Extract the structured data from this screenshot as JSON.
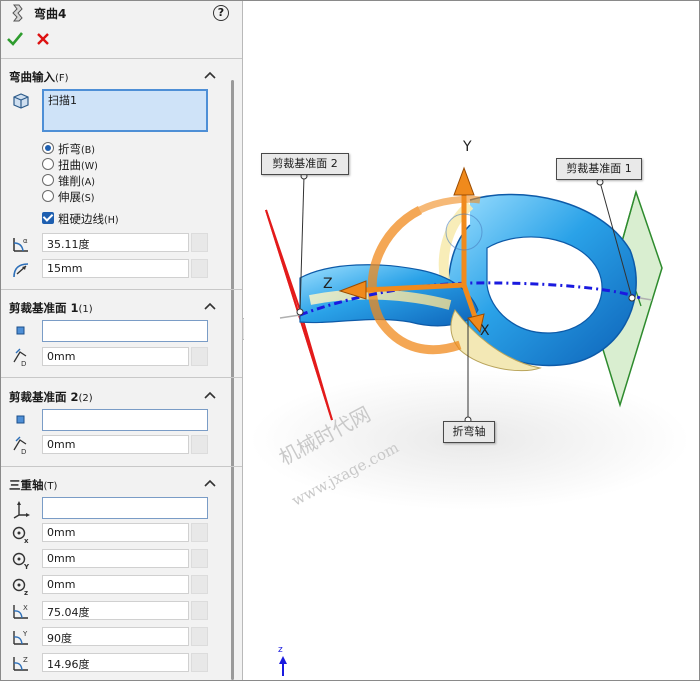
{
  "feature": {
    "title": "弯曲4",
    "help_icon": "help-icon",
    "help_glyph": "?"
  },
  "actions": {
    "ok_icon": "check-icon",
    "cancel_icon": "close-icon"
  },
  "bend_input": {
    "header": "弯曲输入",
    "header_key": "(F)",
    "selected_body": "扫描1",
    "options": [
      {
        "label": "折弯",
        "key": "(B)",
        "selected": true
      },
      {
        "label": "扭曲",
        "key": "(W)",
        "selected": false
      },
      {
        "label": "锥削",
        "key": "(A)",
        "selected": false
      },
      {
        "label": "伸展",
        "key": "(S)",
        "selected": false
      }
    ],
    "hard_edges": {
      "label": "粗硬边线",
      "key": "(H)",
      "checked": true
    },
    "angle": "35.11度",
    "radius": "15mm"
  },
  "trim_plane_1": {
    "header": "剪裁基准面 1",
    "header_key": "(1)",
    "reference": "",
    "distance": "0mm"
  },
  "trim_plane_2": {
    "header": "剪裁基准面 2",
    "header_key": "(2)",
    "reference": "",
    "distance": "0mm"
  },
  "triad": {
    "header": "三重轴",
    "header_key": "(T)",
    "reference": "",
    "x": "0mm",
    "y": "0mm",
    "z": "0mm",
    "rot_x": "75.04度",
    "rot_y": "90度",
    "rot_z": "14.96度"
  },
  "viewport": {
    "callout_plane2": "剪裁基准面 2",
    "callout_plane1": "剪裁基准面 1",
    "callout_axis": "折弯轴",
    "axis_y": "Y",
    "axis_z": "Z",
    "axis_x": "X",
    "view_axis": "z",
    "watermark_cn": "机械时代网",
    "watermark_url": "www.jxage.com",
    "colors": {
      "plane1": "#2e8b2e",
      "plane2": "#e31b1b",
      "triad": "#f08a1c",
      "bend_axis": "#1a1adf",
      "body": "#2aa2e8"
    }
  }
}
